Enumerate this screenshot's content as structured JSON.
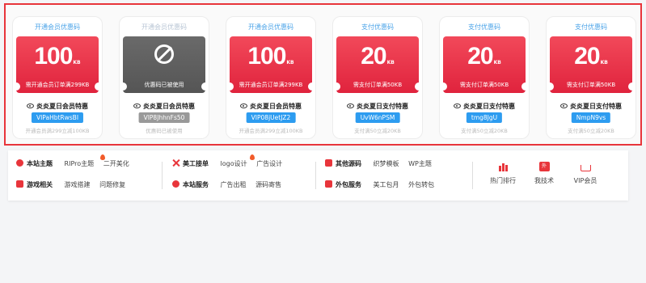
{
  "coupons": [
    {
      "title": "开通会员优惠码",
      "value": "100",
      "unit": "KB",
      "condition": "需开通会员订单满299KB",
      "name": "炎炎夏日会员特惠",
      "code": "VIPaHbtRwsBI",
      "note": "开通会员满299立减100KB",
      "used": false
    },
    {
      "title": "开通会员优惠码",
      "value": "",
      "unit": "",
      "condition": "优惠码已被使用",
      "name": "炎炎夏日会员特惠",
      "code": "VIP8JhhnFs50",
      "note": "优惠码已被使用",
      "used": true
    },
    {
      "title": "开通会员优惠码",
      "value": "100",
      "unit": "KB",
      "condition": "需开通会员订单满299KB",
      "name": "炎炎夏日会员特惠",
      "code": "VIP08jUetJZ2",
      "note": "开通会员满299立减100KB",
      "used": false
    },
    {
      "title": "支付优惠码",
      "value": "20",
      "unit": "KB",
      "condition": "需支付订单满50KB",
      "name": "炎炎夏日支付特惠",
      "code": "UvW6nPSM",
      "note": "支付满50立减20KB",
      "used": false
    },
    {
      "title": "支付优惠码",
      "value": "20",
      "unit": "KB",
      "condition": "需支付订单满50KB",
      "name": "炎炎夏日支付特惠",
      "code": "tmg8JgU",
      "note": "支付满50立减20KB",
      "used": false
    },
    {
      "title": "支付优惠码",
      "value": "20",
      "unit": "KB",
      "condition": "需支付订单满50KB",
      "name": "炎炎夏日支付特惠",
      "code": "NmpN9vs",
      "note": "支付满50立减20KB",
      "used": false
    }
  ],
  "nav": {
    "g1": {
      "row1_head": "本站主题",
      "row1_links": [
        "RIPro主题",
        "二开美化"
      ],
      "row2_head": "游戏相关",
      "row2_links": [
        "游戏搭建",
        "问题修复"
      ]
    },
    "g2": {
      "row1_head": "美工接单",
      "row1_links": [
        "logo设计",
        "广告设计"
      ],
      "row2_head": "本站服务",
      "row2_links": [
        "广告出租",
        "源码寄售"
      ]
    },
    "g3": {
      "row1_head": "其他源码",
      "row1_links": [
        "织梦模板",
        "WP主题"
      ],
      "row2_head": "外包服务",
      "row2_links": [
        "美工包月",
        "外包转包"
      ]
    },
    "quick": [
      {
        "label": "热门排行",
        "icon": "bar-chart-icon"
      },
      {
        "label": "我技术",
        "icon": "tag-icon",
        "badge": "外"
      },
      {
        "label": "VIP会员",
        "icon": "crown-icon"
      }
    ]
  },
  "colors": {
    "accent": "#e8353b",
    "code_blue": "#2d9cf0",
    "title_blue": "#4aa3e8"
  }
}
